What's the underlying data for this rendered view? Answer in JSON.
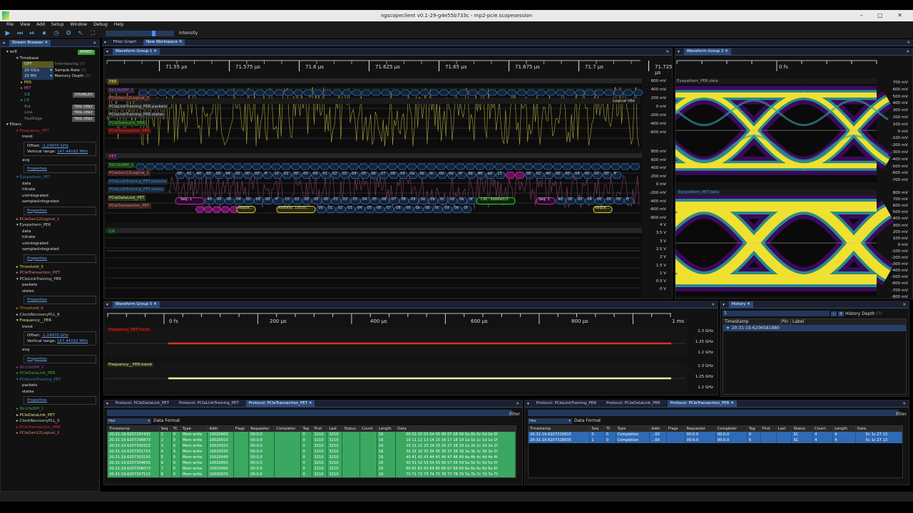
{
  "window": {
    "title": "ngscopeclient v0.1-29-g4e55b733c  - mp2-pcie.scopesession",
    "controls": "– ▢ ✕"
  },
  "menu": [
    "File",
    "View",
    "Add",
    "Setup",
    "Window",
    "Debug",
    "Help"
  ],
  "toolbar": {
    "intensity_label": "Intensity",
    "intensity_value": 0.72
  },
  "stream_browser": {
    "tab": "Stream Browser",
    "instrument": "wr8",
    "armed": "ARMED",
    "timebase": "Timebase",
    "interleaving": {
      "value": "OFF",
      "label": "Interleaving",
      "help": "(?)"
    },
    "sample_rate": {
      "value": "20 GS/s",
      "label": "Sample Rate",
      "help": "(?)"
    },
    "memory_depth": {
      "value": "20 MS",
      "label": "Memory Depth",
      "help": "(?)"
    },
    "channels": [
      {
        "label": "PER",
        "color": "#e8d84a",
        "arrow": "▸",
        "badge": ""
      },
      {
        "label": "PET",
        "color": "#e060c0",
        "arrow": "▸",
        "badge": ""
      },
      {
        "label": "C3",
        "color": "#4ac0c0",
        "arrow": "",
        "badge": "DISABLED"
      },
      {
        "label": "C4",
        "color": "#40b040",
        "arrow": "▸",
        "badge": ""
      },
      {
        "label": "Ext",
        "color": "#888",
        "arrow": "",
        "badge": "TRIG ONLY"
      },
      {
        "label": "Line",
        "color": "#888",
        "arrow": "",
        "badge": "TRIG ONLY"
      },
      {
        "label": "FastEdge",
        "color": "#888",
        "arrow": "",
        "badge": "TRIG ONLY"
      }
    ],
    "filters_label": "Filters",
    "filters": [
      {
        "label": "Frequency_PET",
        "color": "#d03040",
        "open": true,
        "streams": [
          "trend"
        ],
        "offset": "-1.24970 GHz",
        "range": "147.44162 MHz",
        "after": [
          "avg"
        ]
      },
      {
        "label": "Eyepattern_PET",
        "color": "#3a7ab8",
        "open": true,
        "streams": [
          "data",
          "hitrate",
          "uisIntegrated",
          "samplesIntegrated"
        ]
      },
      {
        "label": "PCIeGen12Logical_1",
        "color": "#e08070",
        "open": false
      },
      {
        "label": "Eyepattern_PER",
        "color": "#cccccc",
        "open": true,
        "streams": [
          "data",
          "hitrate",
          "uisIntegrated",
          "samplesIntegrated"
        ]
      },
      {
        "label": "Threshold_5",
        "color": "#e8d84a",
        "open": false
      },
      {
        "label": "PCIeTransaction_PET",
        "color": "#e08070",
        "open": false
      },
      {
        "label": "PCIeLinkTraining_PER",
        "color": "#cccccc",
        "open": true,
        "streams": [
          "packets",
          "states"
        ]
      },
      {
        "label": "Threshold_6",
        "color": "#e08030",
        "open": false
      },
      {
        "label": "ClockRecoveryPLL_6",
        "color": "#cccccc",
        "open": false
      },
      {
        "label": "Frequency__PER",
        "color": "#e8e090",
        "open": true,
        "streams": [
          "trend"
        ],
        "offset": "-1.24970 GHz",
        "range": "147.44162 MHz",
        "after": [
          "avg"
        ]
      },
      {
        "label": "8b10bIBM_2",
        "color": "#8050a0",
        "open": false
      },
      {
        "label": "PCIeDataLink_PER",
        "color": "#40b040",
        "open": false
      },
      {
        "label": "PCIeLinkTraining_PET",
        "color": "#3a7ab8",
        "open": true,
        "streams": [
          "packets",
          "states"
        ]
      },
      {
        "label": "8b10bIBM_1",
        "color": "#40a040",
        "open": false
      },
      {
        "label": "PCIeDataLink_PET",
        "color": "#e8e090",
        "open": false
      },
      {
        "label": "ClockRecoveryPLL_5",
        "color": "#cccccc",
        "open": false
      },
      {
        "label": "PCIeTransaction_PER",
        "color": "#d03040",
        "open": false
      },
      {
        "label": "PCIeGen12Logical_2",
        "color": "#e08070",
        "open": false
      }
    ],
    "offset_label": "Offset:",
    "range_label": "Vertical range:",
    "properties": "Properties"
  },
  "workspace_tabs": [
    "Filter Graph",
    "New Workspace"
  ],
  "wg1": {
    "tab": "Waveform Group 1",
    "ticks": [
      "71.55 µs",
      "71.575 µs",
      "71.6 µs",
      "71.625 µs",
      "71.65 µs",
      "71.675 µs",
      "71.7 µs",
      "71.725 µs"
    ],
    "per": {
      "labels": [
        {
          "t": "PER",
          "c": "#e8d84a",
          "bg": "#4a4520"
        },
        {
          "t": "8b10bIBM_2",
          "c": "#9060b0",
          "bg": "#2a1e36"
        },
        {
          "t": "PCIeGen12Logical_2",
          "c": "#e08070",
          "bg": "#3a2220"
        },
        {
          "t": "PCIeLinkTraining_PER.packets",
          "c": "#ccc",
          "bg": "#2a2a2a"
        },
        {
          "t": "PCIeLinkTraining_PER.states",
          "c": "#ccc",
          "bg": "#2a2a2a"
        },
        {
          "t": "PCIeDataLink_PER",
          "c": "#40c040",
          "bg": "#1a3a1a"
        },
        {
          "t": "PCIeTransaction_PER",
          "c": "#e04040",
          "bg": "#4a1010"
        }
      ],
      "axis": [
        "600 mV",
        "400 mV",
        "200 mV",
        "0 mV",
        "-200 mV",
        "-400 mV",
        "-600 mV"
      ],
      "logical_idle": "Logical Idle"
    },
    "pet": {
      "labels": [
        {
          "t": "PET",
          "c": "#e060c0",
          "bg": "#3a1a30"
        },
        {
          "t": "8b10bIBM_1",
          "c": "#40c040",
          "bg": "#1a3a1a"
        },
        {
          "t": "PCIeGen12Logical_1",
          "c": "#e08070",
          "bg": "#3a2220"
        },
        {
          "t": "PCIeLinkTraining_PET.packets",
          "c": "#4a8ad0",
          "bg": "#1a2a3a"
        },
        {
          "t": "PCIeLinkTraining_PET.states",
          "c": "#4a8ad0",
          "bg": "#1a2a3a"
        },
        {
          "t": "PCIeDataLink_PET",
          "c": "#e8e090",
          "bg": "#2a3a1a"
        },
        {
          "t": "PCIeTransaction_PET",
          "c": "#e08070",
          "bg": "#3a2220"
        }
      ],
      "axis": [
        "800 mV",
        "600 mV",
        "400 mV",
        "200 mV",
        "0 mV",
        "-200 mV",
        "-400 mV",
        "-600 mV",
        "-800 mV"
      ],
      "logical_bytes": [
        "00",
        "01",
        "40",
        "00",
        "00",
        "04",
        "00",
        "00",
        "00",
        "ff",
        "10",
        "02",
        "00",
        "00",
        "00",
        "01",
        "02",
        "03",
        "04",
        "05",
        "06",
        "07",
        "08",
        "09",
        "0a",
        "0b",
        "0c",
        "0d",
        "0e",
        "0f",
        "6b",
        "86",
        "ad",
        "15",
        "",
        "",
        "00",
        "02",
        "40",
        "00",
        "00",
        "04",
        "00",
        "00",
        "00",
        "ff"
      ],
      "dl": {
        "seq1": "Seq: 1",
        "crc": "CRC: 6b86ad15",
        "seq2": "Seq: 2",
        "bytes1": [
          "40",
          "00",
          "00",
          "04",
          "00",
          "00",
          "00",
          "ff",
          "10",
          "02",
          "00",
          "00",
          "00",
          "01",
          "02",
          "03",
          "04",
          "05",
          "06",
          "07",
          "08",
          "09",
          "0a",
          "0b",
          "0c",
          "0d",
          "0e",
          "0f"
        ],
        "bytes2": [
          "40",
          "00",
          "00",
          "04",
          "00",
          "00",
          "00",
          "ff"
        ]
      },
      "tl": {
        "req": "Reque...",
        "addr": "Address: 10020...",
        "bytes": [
          "00",
          "01",
          "02",
          "03",
          "04",
          "05",
          "06",
          "07",
          "08",
          "09",
          "0a",
          "0b",
          "0c",
          "0d",
          "0e",
          "0f"
        ]
      }
    },
    "c4": {
      "label": "C4",
      "axis": [
        "4 V",
        "3.5 V",
        "3 V",
        "2.5 V",
        "2 V",
        "1.5 V",
        "1 V",
        "0.5 V",
        "0 V"
      ]
    }
  },
  "wg2": {
    "tab": "Waveform Group 2",
    "tick": "0 fs",
    "per": {
      "label": "Eyepattern_PER.data",
      "axis": [
        "700 mV",
        "600 mV",
        "500 mV",
        "400 mV",
        "300 mV",
        "200 mV",
        "100 mV",
        "0 mV",
        "-100 mV",
        "-200 mV",
        "-300 mV",
        "-400 mV",
        "-500 mV",
        "-600 mV",
        "-700 mV"
      ]
    },
    "pet": {
      "label": "Eyepattern_PET.data",
      "axis": [
        "800 mV",
        "700 mV",
        "600 mV",
        "500 mV",
        "400 mV",
        "300 mV",
        "200 mV",
        "100 mV",
        "0 mV",
        "-100 mV",
        "-200 mV",
        "-300 mV",
        "-400 mV",
        "-500 mV",
        "-600 mV",
        "-700 mV",
        "-800 mV"
      ]
    }
  },
  "wg5": {
    "tab": "Waveform Group 5",
    "ticks": [
      "0 fs",
      "200 µs",
      "400 µs",
      "600 µs",
      "800 µs",
      "1 ms"
    ],
    "traces": [
      {
        "label": "Frequency_PET.trend",
        "color": "#e03030",
        "axis": [
          "1.3 GHz",
          "1.25 GHz",
          "1.2 GHz"
        ]
      },
      {
        "label": "Frequency__PER.trend",
        "color": "#f0f0a0",
        "axis": [
          "1.3 GHz",
          "1.25 GHz",
          "1.2 GHz"
        ]
      }
    ]
  },
  "history": {
    "tab": "History",
    "depth_value": "1",
    "minus": "-",
    "plus": "+",
    "depth_label": "History Depth",
    "help": "(?)",
    "columns": [
      "Timestamp",
      "Pin",
      "Label"
    ],
    "rows": [
      {
        "timestamp": "20:31:19.6206581880"
      }
    ]
  },
  "protocol_left": {
    "tabs": [
      "Protocol: PCIeDataLink_PET",
      "Protocol: PCIeLinkTraining_PET",
      "Protocol: PCIeTransaction_PET"
    ],
    "filter": "Filter",
    "format": "Hex",
    "format_label": "Data Format",
    "columns": [
      "Timestamp",
      "Seq",
      "TC",
      "Type",
      "Addr",
      "Flags",
      "Requester",
      "Completer",
      "Tag",
      "First",
      "Last",
      "Status",
      "Count",
      "Length",
      "Data"
    ],
    "rows": [
      [
        "20:31:19.6207297433",
        "1",
        "0",
        "Mem write",
        "10020000",
        "",
        "00:0.0",
        "",
        "0",
        "3210",
        "3210",
        "",
        "",
        "16",
        "00 01 02 03 04 05 06 07 08 09 0a 0b 0c 0d 0e 0f"
      ],
      [
        "20:31:19.6207298873",
        "2",
        "0",
        "Mem write",
        "10020010",
        "",
        "00:0.0",
        "",
        "0",
        "3210",
        "3210",
        "",
        "",
        "16",
        "10 11 12 13 14 15 16 17 18 19 1a 1b 1c 1d 1e 1f"
      ],
      [
        "20:31:19.6207300313",
        "3",
        "0",
        "Mem write",
        "10020020",
        "",
        "00:0.0",
        "",
        "0",
        "3210",
        "3210",
        "",
        "",
        "16",
        "20 21 22 23 24 25 26 27 28 29 2a 2b 2c 2d 2e 2f"
      ],
      [
        "20:31:19.6207301753",
        "4",
        "0",
        "Mem write",
        "10020030",
        "",
        "00:0.0",
        "",
        "0",
        "3210",
        "3210",
        "",
        "",
        "16",
        "30 31 32 33 34 35 36 37 38 39 3a 3b 3c 3d 3e 3f"
      ],
      [
        "20:31:19.6207303193",
        "5",
        "0",
        "Mem write",
        "10020040",
        "",
        "00:0.0",
        "",
        "0",
        "3210",
        "3210",
        "",
        "",
        "16",
        "40 41 42 43 44 45 46 47 48 49 4a 4b 4c 4d 4e 4f"
      ],
      [
        "20:31:19.6207304633",
        "6",
        "0",
        "Mem write",
        "10020050",
        "",
        "00:0.0",
        "",
        "0",
        "3210",
        "3210",
        "",
        "",
        "16",
        "50 51 52 53 54 55 56 57 58 59 5a 5b 5c 5d 5e 5f"
      ],
      [
        "20:31:19.6207306073",
        "7",
        "0",
        "Mem write",
        "10020060",
        "",
        "00:0.0",
        "",
        "0",
        "3210",
        "3210",
        "",
        "",
        "16",
        "60 61 62 63 64 65 66 67 68 69 6a 6b 6c 6d 6e 6f"
      ],
      [
        "20:31:19.6207307513",
        "8",
        "0",
        "Mem write",
        "10020070",
        "",
        "00:0.0",
        "",
        "0",
        "3210",
        "3210",
        "",
        "",
        "16",
        "70 71 72 73 74 75 76 77 78 79 7a 7b 7c 7d 7e 7f"
      ]
    ]
  },
  "protocol_right": {
    "tabs": [
      "Protocol: PCIeLinkTraining_PER",
      "Protocol: PCIeDataLink_PER",
      "Protocol: PCIeTransaction_PER"
    ],
    "filter": "Filter",
    "format": "Hex",
    "format_label": "Data Format",
    "columns": [
      "Timestamp",
      "Seq",
      "TC",
      "Type",
      "Addr",
      "Flags",
      "Requester",
      "Completer",
      "Tag",
      "First",
      "Last",
      "Status",
      "Count",
      "Length",
      "Data"
    ],
    "rows": [
      [
        "20:31:19.6207315815",
        "0",
        "0",
        "Completion",
        "...00",
        "",
        "00:0.0",
        "00:0.0",
        "0",
        "",
        "",
        "SC",
        "4",
        "4",
        "5c 1c 27 13"
      ],
      [
        "20:31:19.6207328935",
        "1",
        "0",
        "Completion",
        "...00",
        "",
        "00:0.0",
        "00:0.0",
        "6",
        "",
        "",
        "SC",
        "4",
        "4",
        "5c 1c 27 13"
      ]
    ]
  }
}
